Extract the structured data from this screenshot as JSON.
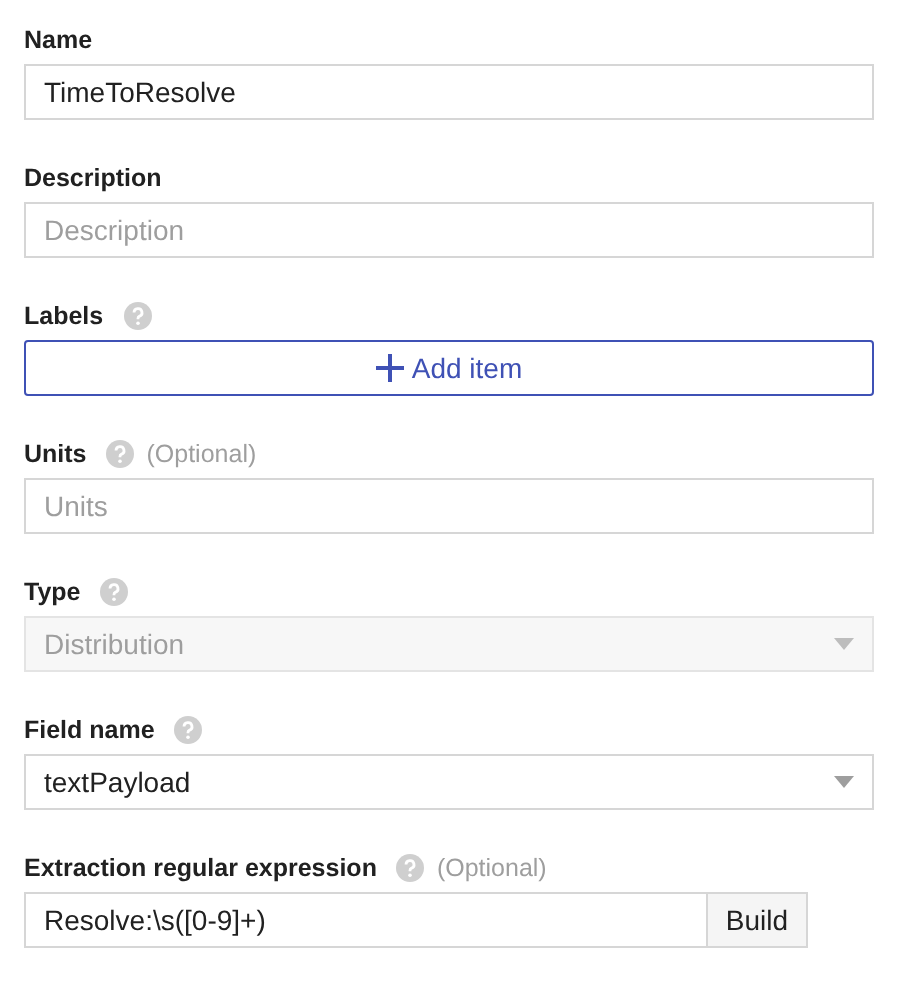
{
  "fields": [
    {
      "label": "Name",
      "help": false,
      "control": {
        "kind": "text",
        "value": "TimeToResolve"
      }
    },
    {
      "label": "Description",
      "help": false,
      "control": {
        "kind": "text",
        "placeholder": "Description"
      }
    },
    {
      "label": "Labels",
      "help": true,
      "control": {
        "kind": "add",
        "text": "Add item"
      }
    },
    {
      "label": "Units",
      "help": true,
      "optional": "(Optional)",
      "control": {
        "kind": "text",
        "placeholder": "Units"
      }
    },
    {
      "label": "Type",
      "help": true,
      "control": {
        "kind": "select",
        "value": "Distribution",
        "disabled": true
      }
    },
    {
      "label": "Field name",
      "help": true,
      "control": {
        "kind": "select",
        "value": "textPayload",
        "disabled": false
      }
    },
    {
      "label": "Extraction regular expression",
      "help": true,
      "optional": "(Optional)",
      "control": {
        "kind": "build",
        "value": "Resolve:\\s([0-9]+)",
        "button": "Build"
      }
    }
  ]
}
